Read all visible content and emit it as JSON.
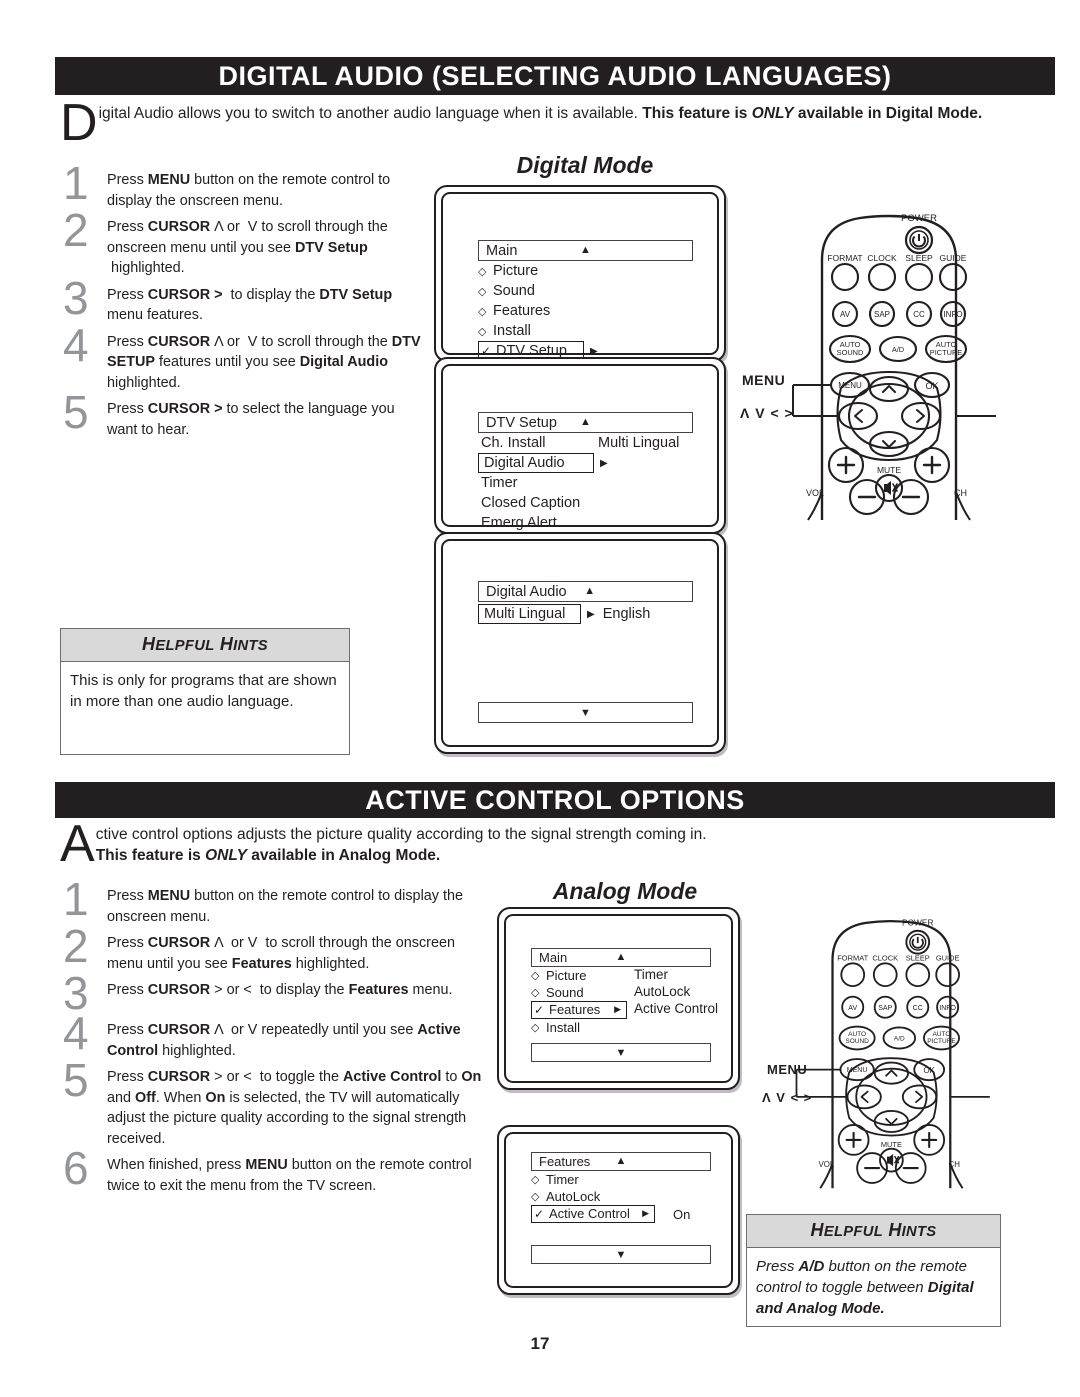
{
  "page": {
    "number": "17"
  },
  "section1": {
    "banner": "DIGITAL AUDIO (SELECTING AUDIO LANGUAGES)",
    "intro_dropcap": "D",
    "intro_rest": "igital Audio allows you to switch to another audio language when it is available. ",
    "intro_bold1": "This feature is ",
    "intro_bold_italic": "ONLY",
    "intro_bold2": " available in Digital Mode.",
    "mode_caption": "Digital Mode",
    "steps": [
      {
        "num": "1",
        "html": "Press <b>MENU</b> button on the remote control to display the onscreen menu."
      },
      {
        "num": "2",
        "html": "Press <b>CURSOR</b> &#923; or &nbsp;V to scroll through the onscreen menu until you see <b>DTV Setup</b> &nbsp;highlighted."
      },
      {
        "num": "3",
        "html": "Press <b>CURSOR  &gt;</b> &nbsp;to display the <b>DTV Setup</b> menu features."
      },
      {
        "num": "4",
        "html": "Press <b>CURSOR</b> &#923; or &nbsp;V to scroll through the <b>DTV SETUP</b> features until you see <b>Digital Audio</b> highlighted."
      },
      {
        "num": "5",
        "html": "Press <b>CURSOR &gt;</b> to select the language you want to hear."
      }
    ],
    "hints": {
      "title": "HELPFUL HINTS",
      "body": "This is only for programs that are shown in more than one audio language."
    },
    "screen1": {
      "title": "Main",
      "items": [
        "Picture",
        "Sound",
        "Features",
        "Install"
      ],
      "selected": "DTV Setup"
    },
    "screen2": {
      "title": "DTV Setup",
      "items": [
        "Ch. Install",
        "Timer",
        "Closed Caption",
        "Emerg Alert"
      ],
      "selected": "Digital Audio",
      "col2": "Multi Lingual"
    },
    "screen3": {
      "title": "Digital Audio",
      "selected": "Multi Lingual",
      "value": "English"
    }
  },
  "section2": {
    "banner": "ACTIVE CONTROL OPTIONS",
    "intro_dropcap": "A",
    "intro_rest": "ctive control options adjusts the picture quality according to the signal strength coming in.",
    "intro_bold1": "This feature is ",
    "intro_bold_italic": "ONLY",
    "intro_bold2": " available in Analog Mode.",
    "mode_caption": "Analog Mode",
    "steps": [
      {
        "num": "1",
        "html": "Press <b>MENU</b> button on the remote control to display the onscreen menu."
      },
      {
        "num": "2",
        "html": "Press <b>CURSOR</b> &#923; &nbsp;or V &nbsp;to scroll through the onscreen menu until you see <b>Features</b> highlighted."
      },
      {
        "num": "3",
        "html": "Press <b>CURSOR</b>  &gt; or &lt; &nbsp;to display the <b>Features</b> menu."
      },
      {
        "num": "4",
        "html": "Press <b>CURSOR</b> &#923; &nbsp;or V repeatedly until you see <b>Active Control</b> highlighted."
      },
      {
        "num": "5",
        "html": "Press <b>CURSOR</b> &gt; or &lt; &nbsp;to toggle the <b>Active Control</b> to <b>On</b> and <b>Off</b>.  When <b>On</b> is selected, the TV will automatically adjust the picture quality according to the signal strength received."
      },
      {
        "num": "6",
        "html": "When finished, press <b>MENU</b> button on the remote control twice to exit the menu from the TV screen."
      }
    ],
    "hints": {
      "title": "HELPFUL HINTS",
      "body_html": "Press <b>A/D</b> button on the remote control to toggle between <b>Digital and Analog Mode.</b>"
    },
    "screen1": {
      "title": "Main",
      "items": [
        "Picture",
        "Sound",
        "Install"
      ],
      "selected": "Features",
      "col2": [
        "Timer",
        "AutoLock",
        "Active Control"
      ]
    },
    "screen2": {
      "title": "Features",
      "items": [
        "Timer",
        "AutoLock"
      ],
      "selected": "Active Control",
      "value": "On"
    }
  },
  "remote": {
    "power_label": "POWER",
    "row1": [
      "FORMAT",
      "CLOCK",
      "SLEEP",
      "GUIDE"
    ],
    "row2": [
      "AV",
      "SAP",
      "CC",
      "INFO"
    ],
    "row3": [
      "AUTO SOUND",
      "A/D",
      "AUTO PICTURE"
    ],
    "menu_button": "MENU",
    "ok_button": "OK",
    "mute_label": "MUTE",
    "vol_label": "VOL",
    "ch_label": "CH",
    "callout_menu": "MENU",
    "callout_cursor": "Λ V < >"
  },
  "colors": {
    "banner_bg": "#231f20",
    "step_number": "#939598",
    "hints_header_bg": "#d9d9d9",
    "line": "#231f20"
  }
}
